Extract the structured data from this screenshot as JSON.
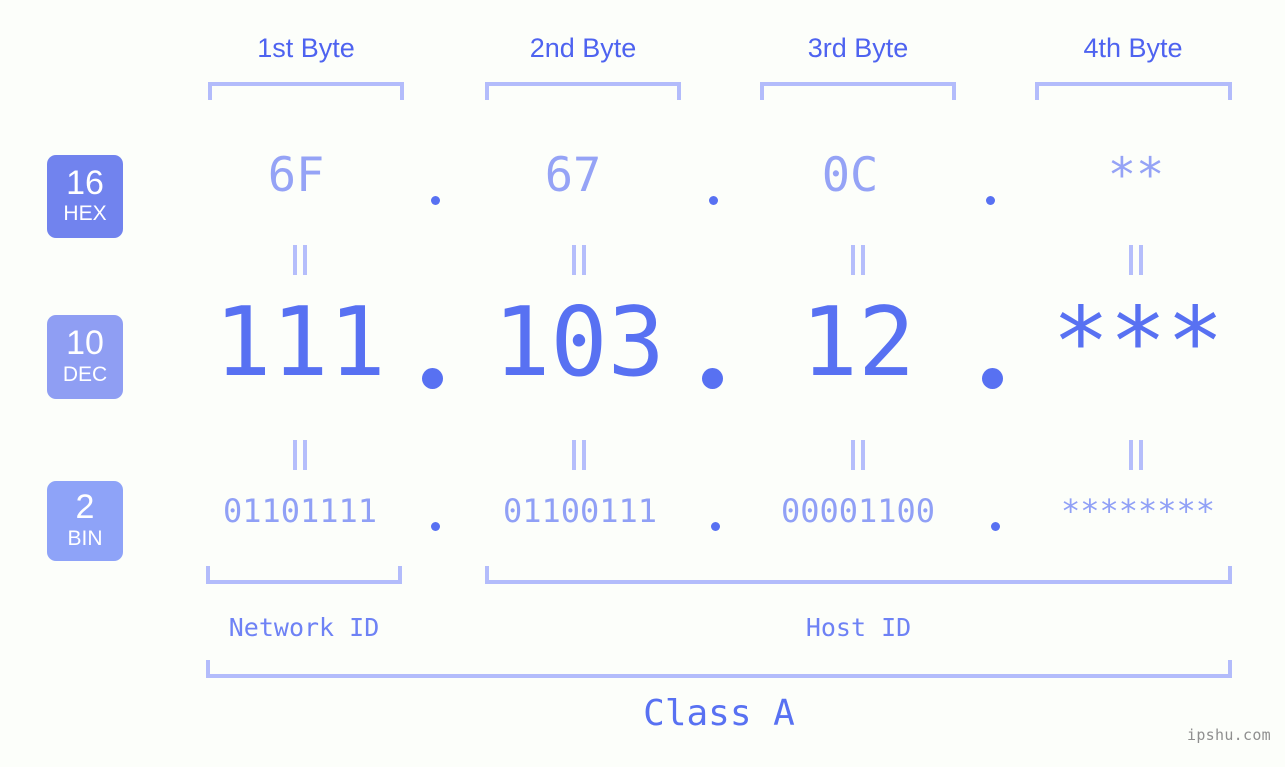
{
  "watermark": "ipshu.com",
  "byte_headers": [
    {
      "label": "1st Byte"
    },
    {
      "label": "2nd Byte"
    },
    {
      "label": "3rd Byte"
    },
    {
      "label": "4th Byte"
    }
  ],
  "radix_badges": [
    {
      "number": "16",
      "name": "HEX",
      "color": "#7183ee"
    },
    {
      "number": "10",
      "name": "DEC",
      "color": "#8f9ef3"
    },
    {
      "number": "2",
      "name": "BIN",
      "color": "#8ea3f8"
    }
  ],
  "rows": {
    "hex": {
      "radix": "16",
      "radix_name": "HEX",
      "values": [
        "6F",
        "67",
        "0C",
        "**"
      ]
    },
    "dec": {
      "radix": "10",
      "radix_name": "DEC",
      "values": [
        "111",
        "103",
        "12",
        "***"
      ]
    },
    "bin": {
      "radix": "2",
      "radix_name": "BIN",
      "values": [
        "01101111",
        "01100111",
        "00001100",
        "********"
      ]
    }
  },
  "separator": ".",
  "equals_glyph": "=",
  "id_sections": [
    {
      "label": "Network ID"
    },
    {
      "label": "Host ID"
    }
  ],
  "class_section": {
    "label": "Class A"
  },
  "colors": {
    "background": "#fcfefa",
    "header_text": "#4e63f0",
    "bracket": "#b3bcfb",
    "hex_text": "#95a3f6",
    "dec_text": "#5871f2",
    "bin_text": "#90a0f6",
    "dot": "#5871f2",
    "equals": "#b5befb",
    "id_text": "#6e82f5",
    "class_text": "#5871f2",
    "watermark_text": "#8f8f8f"
  }
}
